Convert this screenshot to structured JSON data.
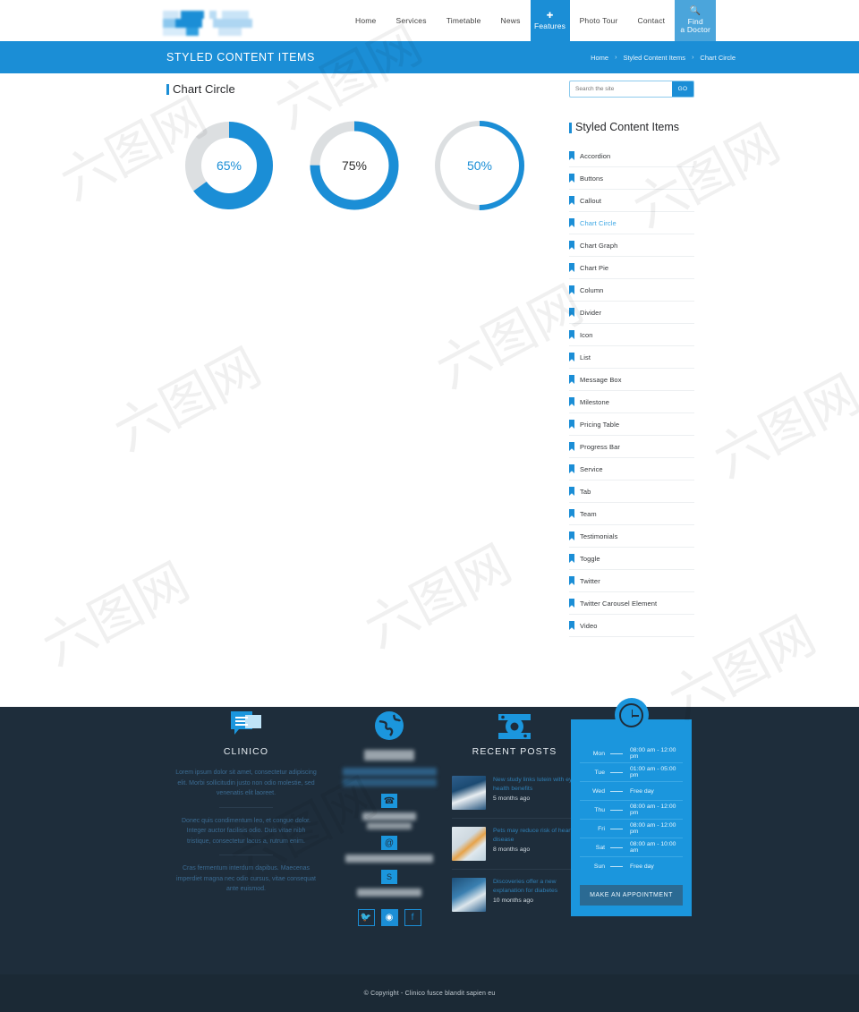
{
  "header": {
    "logo_alt": "clinico-logo",
    "nav": [
      {
        "label": "Home",
        "state": "normal"
      },
      {
        "label": "Services",
        "state": "normal"
      },
      {
        "label": "Timetable",
        "state": "normal"
      },
      {
        "label": "News",
        "state": "normal"
      },
      {
        "label": "Features",
        "state": "active",
        "icon": "plus-icon"
      },
      {
        "label": "Photo Tour",
        "state": "normal"
      },
      {
        "label": "Contact",
        "state": "normal"
      },
      {
        "label": "Find a Doctor",
        "state": "cta",
        "icon": "search-icon",
        "line1": "Find",
        "line2": "a Doctor"
      }
    ]
  },
  "titlebar": {
    "title": "STYLED CONTENT ITEMS",
    "breadcrumbs": [
      "Home",
      "Styled Content Items",
      "Chart Circle"
    ],
    "separator": "›",
    "bg_color": "#1b8ed6"
  },
  "main": {
    "section_title": "Chart Circle",
    "chart_data": {
      "type": "pie",
      "title": "Chart Circle",
      "charts": [
        {
          "label": "65%",
          "value": 65,
          "track": 100,
          "stroke_px": 18,
          "radius": 40,
          "text_color": "#1b8ed6",
          "fill_color": "#1b8ed6",
          "track_color": "#dcdfe1"
        },
        {
          "label": "75%",
          "value": 75,
          "track": 100,
          "stroke_px": 11,
          "radius": 44,
          "text_color": "#2b2b2b",
          "fill_color": "#1b8ed6",
          "track_color": "#dcdfe1"
        },
        {
          "label": "50%",
          "value": 50,
          "track": 100,
          "stroke_px": 6,
          "radius": 47,
          "text_color": "#1b8ed6",
          "fill_color": "#1b8ed6",
          "track_color": "#dcdfe1"
        }
      ],
      "categories": [
        "65%",
        "75%",
        "50%"
      ],
      "values": [
        65,
        75,
        50
      ],
      "ylim": [
        0,
        100
      ],
      "xlabel": "",
      "ylabel": ""
    }
  },
  "sidebar": {
    "search": {
      "placeholder": "Search the site",
      "value": "",
      "button_label": "GO"
    },
    "title": "Styled Content Items",
    "items": [
      {
        "label": "Accordion",
        "active": false
      },
      {
        "label": "Buttons",
        "active": false
      },
      {
        "label": "Callout",
        "active": false
      },
      {
        "label": "Chart Circle",
        "active": true
      },
      {
        "label": "Chart Graph",
        "active": false
      },
      {
        "label": "Chart Pie",
        "active": false
      },
      {
        "label": "Column",
        "active": false
      },
      {
        "label": "Divider",
        "active": false
      },
      {
        "label": "Icon",
        "active": false
      },
      {
        "label": "List",
        "active": false
      },
      {
        "label": "Message Box",
        "active": false
      },
      {
        "label": "Milestone",
        "active": false
      },
      {
        "label": "Pricing Table",
        "active": false
      },
      {
        "label": "Progress Bar",
        "active": false
      },
      {
        "label": "Service",
        "active": false
      },
      {
        "label": "Tab",
        "active": false
      },
      {
        "label": "Team",
        "active": false
      },
      {
        "label": "Testimonials",
        "active": false
      },
      {
        "label": "Toggle",
        "active": false
      },
      {
        "label": "Twitter",
        "active": false
      },
      {
        "label": "Twitter Carousel Element",
        "active": false
      },
      {
        "label": "Video",
        "active": false
      }
    ]
  },
  "footer": {
    "about": {
      "icon": "chat-bubbles-icon",
      "heading": "CLINICO",
      "paragraph1": "Lorem ipsum dolor sit amet, consectetur adipiscing elit. Morbi sollicitudin justo non odio molestie, sed venenatis elit laoreet.",
      "paragraph2": "Donec quis condimentum leo, et congue dolor. Integer auctor facilisis odio. Duis vitae nibh tristique, consectetur lacus a, rutrum enim.",
      "paragraph3": "Cras fermentum interdum dapibus. Maecenas imperdiet magna nec odio cursus, vitae consequat ante euismod."
    },
    "contact": {
      "icon": "globe-icon",
      "phone_icon": "phone-icon",
      "email_icon": "at-sign-icon",
      "skype_icon": "skype-icon",
      "social": [
        {
          "name": "twitter-icon",
          "glyph": "🐦",
          "filled": false
        },
        {
          "name": "instagram-icon",
          "glyph": "◉",
          "filled": true
        },
        {
          "name": "facebook-icon",
          "glyph": "f",
          "filled": false
        }
      ]
    },
    "posts": {
      "icon": "camera-icon",
      "heading": "RECENT POSTS",
      "items": [
        {
          "title": "New study links lutein with eye health benefits",
          "date": "5 months ago",
          "thumb": "surgeon-photo"
        },
        {
          "title": "Pets may reduce risk of heart disease",
          "date": "8 months ago",
          "thumb": "pills-photo"
        },
        {
          "title": "Discoveries offer a new explanation for diabetes",
          "date": "10 months ago",
          "thumb": "stethoscope-photo"
        }
      ]
    },
    "schedule": {
      "icon": "clock-icon",
      "rows": [
        {
          "day": "Mon",
          "time": "08:00 am - 12:00 pm"
        },
        {
          "day": "Tue",
          "time": "01:00 am - 05:00 pm"
        },
        {
          "day": "Wed",
          "time": "Free day"
        },
        {
          "day": "Thu",
          "time": "08:00 am - 12:00 pm"
        },
        {
          "day": "Fri",
          "time": "08:00 am - 12:00 pm"
        },
        {
          "day": "Sat",
          "time": "08:00 am - 10:00 am"
        },
        {
          "day": "Sun",
          "time": "Free day"
        }
      ],
      "button_label": "MAKE AN APPOINTMENT"
    },
    "copyright": "© Copyright - Clinico  fusce blandit sapien eu"
  },
  "watermark": {
    "text": "六图网"
  }
}
